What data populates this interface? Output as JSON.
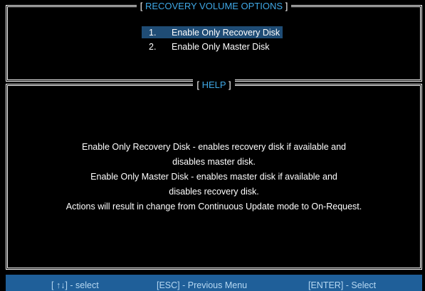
{
  "options_panel": {
    "title_open": "[",
    "title": "RECOVERY VOLUME OPTIONS",
    "title_close": "]",
    "items": [
      {
        "number": "1.",
        "label": "Enable Only Recovery Disk",
        "selected": true
      },
      {
        "number": "2.",
        "label": "Enable Only Master Disk",
        "selected": false
      }
    ]
  },
  "help_panel": {
    "title_open": "[",
    "title": "HELP",
    "title_close": "]",
    "lines": [
      "Enable Only Recovery Disk - enables recovery disk if available and",
      "disables master disk.",
      "Enable Only Master Disk - enables master disk if available and",
      "disables recovery disk.",
      "Actions will result in change from Continuous Update mode to On-Request."
    ]
  },
  "footer": {
    "select_hint": "[ ↑↓] - select",
    "escape_hint": "[ESC] - Previous Menu",
    "enter_hint": "[ENTER] - Select"
  },
  "colors": {
    "background": "#000000",
    "title_accent": "#3fa8e6",
    "selection_highlight": "#1f4c75",
    "footer_bar": "#1f5f99",
    "footer_text": "#b6d8f2"
  }
}
